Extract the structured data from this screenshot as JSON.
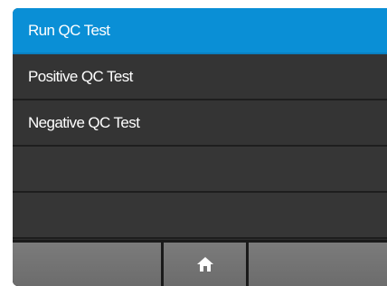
{
  "menu": {
    "items": [
      {
        "label": "Run QC Test",
        "selected": true
      },
      {
        "label": "Positive QC Test",
        "selected": false
      },
      {
        "label": "Negative QC Test",
        "selected": false
      },
      {
        "label": "",
        "selected": false
      },
      {
        "label": "",
        "selected": false
      }
    ]
  },
  "bottom_bar": {
    "buttons": [
      {
        "label": ""
      },
      {
        "icon": "home-icon"
      },
      {
        "label": ""
      }
    ]
  },
  "colors": {
    "selected": "#0a8fd6",
    "item_background": "#343434",
    "bottom_button": "#727272",
    "text": "#ffffff"
  }
}
